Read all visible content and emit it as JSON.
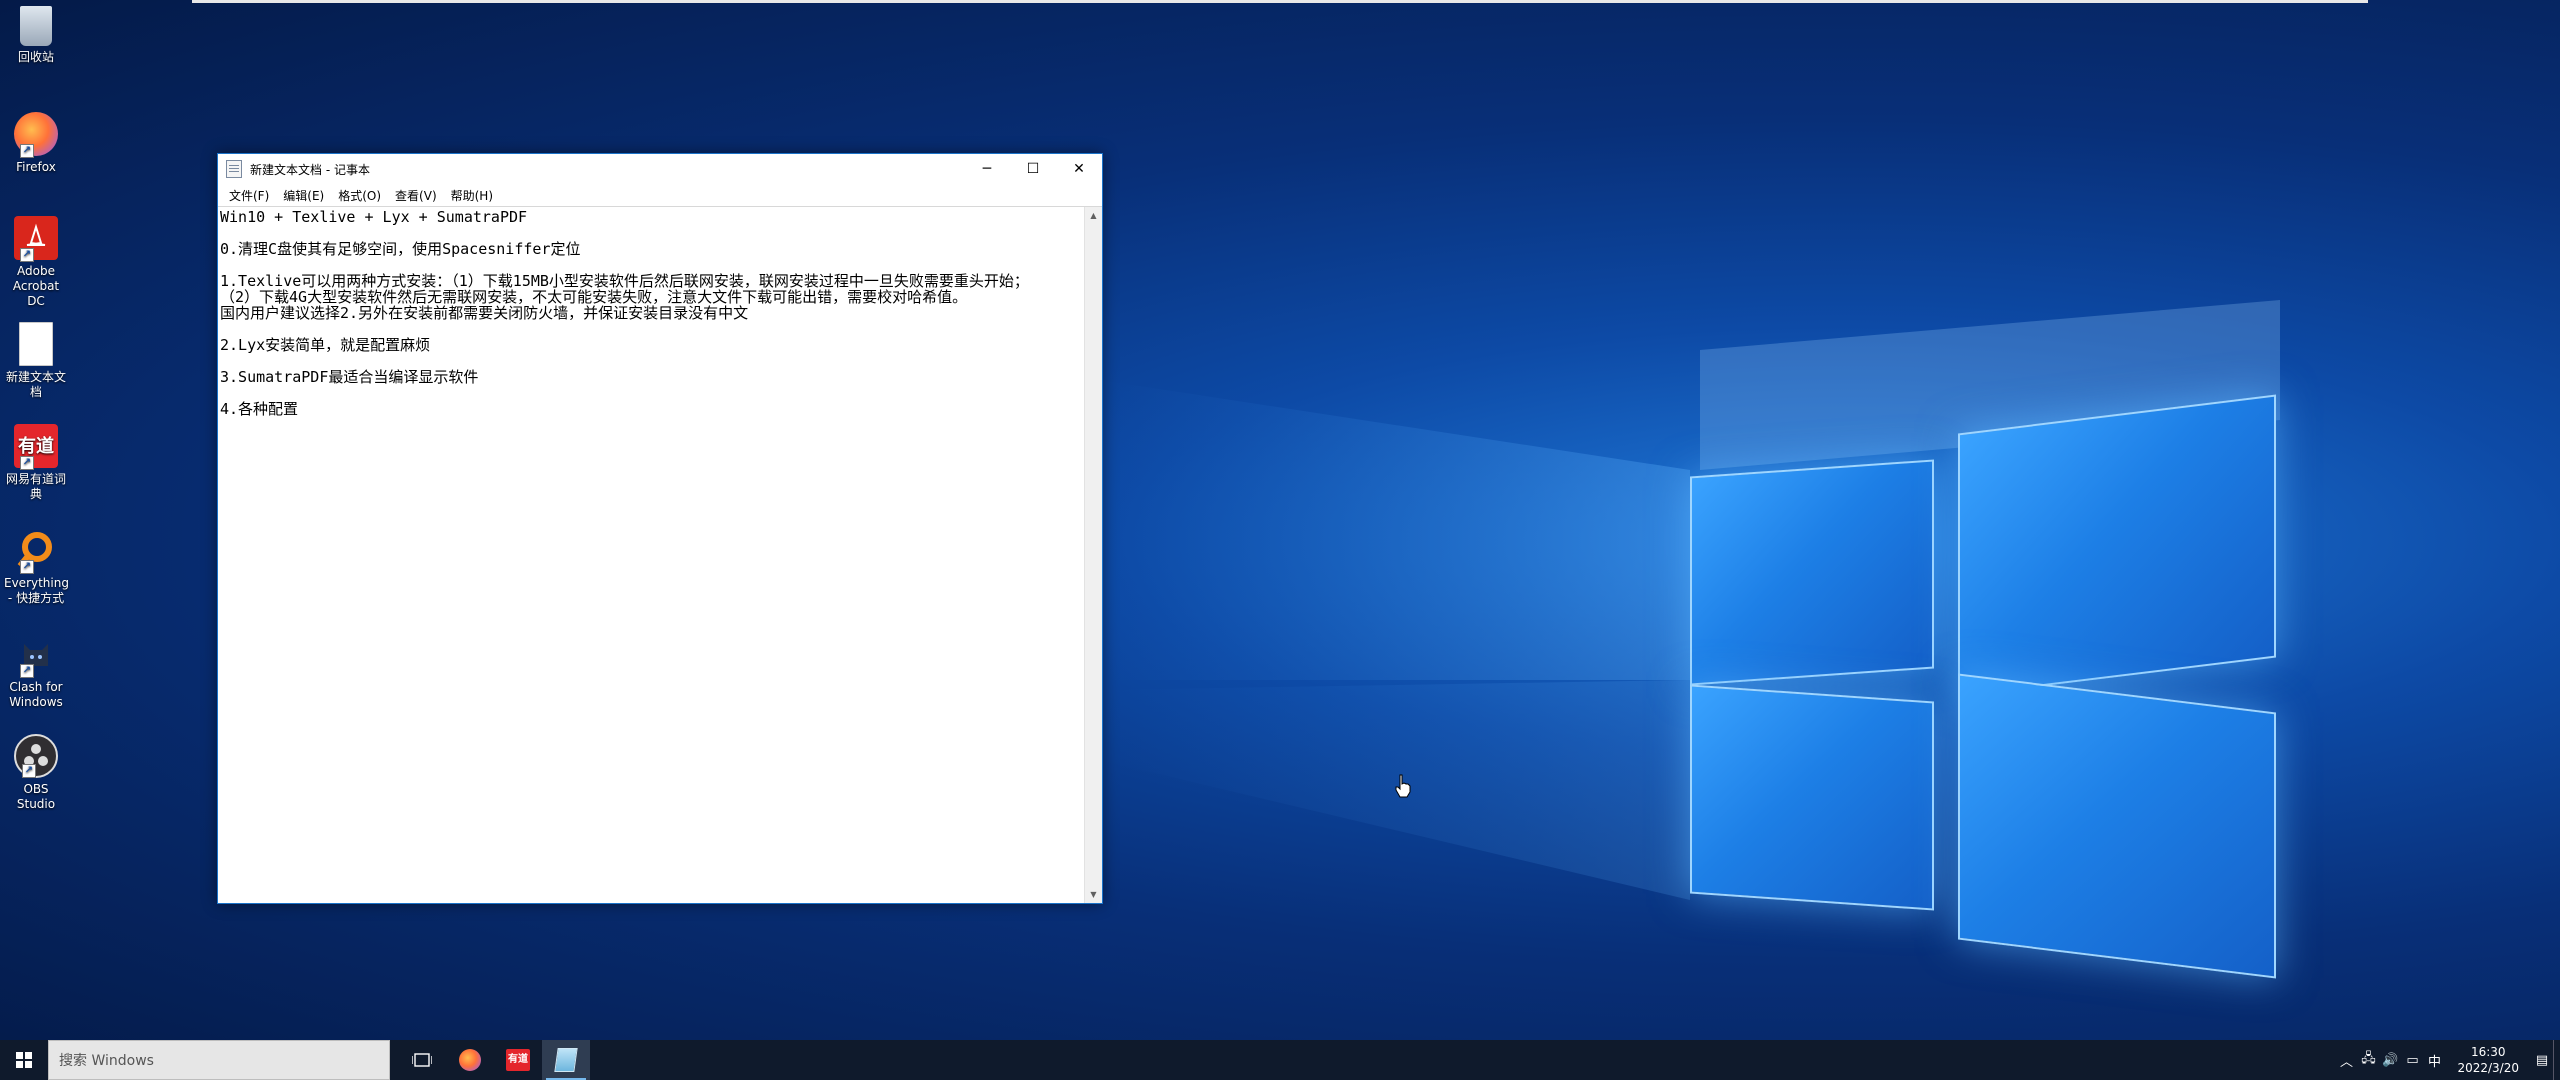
{
  "desktop_icons": [
    {
      "label": "回收站",
      "icon": "recycle-bin-icon"
    },
    {
      "label": "Firefox",
      "icon": "firefox-icon"
    },
    {
      "label": "Adobe Acrobat DC",
      "icon": "acrobat-icon"
    },
    {
      "label": "新建文本文档",
      "icon": "text-file-icon"
    },
    {
      "label": "网易有道词典",
      "icon": "youdao-icon",
      "badge": "有道"
    },
    {
      "label": "Everything - 快捷方式",
      "icon": "everything-icon"
    },
    {
      "label": "Clash for Windows",
      "icon": "clash-icon"
    },
    {
      "label": "OBS Studio",
      "icon": "obs-icon"
    }
  ],
  "notepad": {
    "title": "新建文本文档 - 记事本",
    "menu": [
      "文件(F)",
      "编辑(E)",
      "格式(O)",
      "查看(V)",
      "帮助(H)"
    ],
    "lines": [
      "Win10 + Texlive + Lyx + SumatraPDF",
      "",
      "0.清理C盘使其有足够空间，使用Spacesniffer定位",
      "",
      "1.Texlive可以用两种方式安装：（1）下载15MB小型安装软件后然后联网安装，联网安装过程中一旦失败需要重头开始；",
      "（2）下载4G大型安装软件然后无需联网安装，不太可能安装失败，注意大文件下载可能出错，需要校对哈希值。",
      "国内用户建议选择2.另外在安装前都需要关闭防火墙，并保证安装目录没有中文",
      "",
      "2.Lyx安装简单，就是配置麻烦",
      "",
      "3.SumatraPDF最适合当编译显示软件",
      "",
      "4.各种配置"
    ]
  },
  "taskbar": {
    "search_placeholder": "搜索 Windows",
    "apps": [
      "task-view-icon",
      "firefox-icon",
      "youdao-icon",
      "notepad-icon"
    ],
    "youdao_badge": "有道",
    "ime": "中",
    "time": "16:30",
    "date": "2022/3/20"
  },
  "colors": {
    "accent": "#1a73c9",
    "taskbar": "#0f1a2c",
    "youdao_red": "#e4262c",
    "acrobat_red": "#d9261c"
  }
}
